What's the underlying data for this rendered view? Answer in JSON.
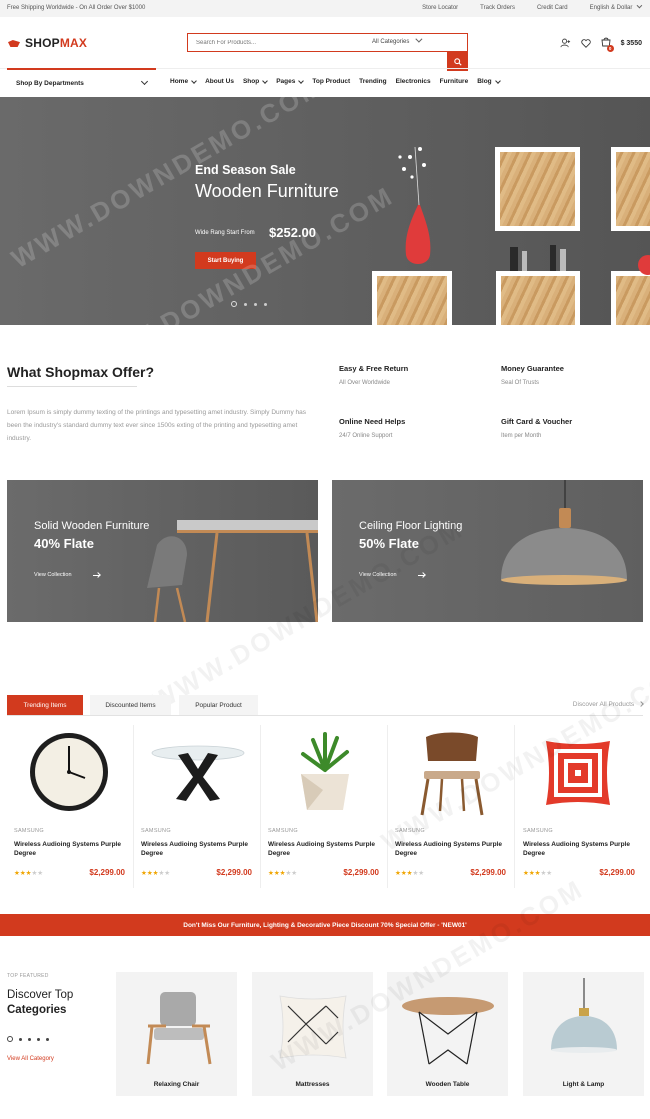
{
  "topbar": {
    "shipping": "Free Shipping Worldwide - On All Order Over $1000",
    "links": [
      "Store Locator",
      "Track Orders",
      "Credit Card",
      "English & Dollar"
    ]
  },
  "header": {
    "logo_part1": "SHOP",
    "logo_part2": "MAX",
    "search_placeholder": "Search For Products...",
    "category_select": "All Categories",
    "cart_total": "$ 3550",
    "cart_count": "0"
  },
  "nav": {
    "departments": "Shop By Departments",
    "items": [
      {
        "label": "Home",
        "dropdown": true
      },
      {
        "label": "About Us",
        "dropdown": false
      },
      {
        "label": "Shop",
        "dropdown": true
      },
      {
        "label": "Pages",
        "dropdown": true
      },
      {
        "label": "Top Product",
        "dropdown": false
      },
      {
        "label": "Trending",
        "dropdown": false
      },
      {
        "label": "Electronics",
        "dropdown": false
      },
      {
        "label": "Furniture",
        "dropdown": false
      },
      {
        "label": "Blog",
        "dropdown": true
      }
    ]
  },
  "hero": {
    "headline": "End Season Sale",
    "title": "Wooden Furniture",
    "from_text": "Wide Rang Start From",
    "price": "$252.00",
    "button": "Start Buying"
  },
  "offer": {
    "title": "What Shopmax Offer?",
    "description": "Lorem Ipsum is simply dummy texting of the printings and typesetting amet industry. Simply Dummy has been the industry's standard dummy text ever since 1500s exting of the printing and typesetting amet industry.",
    "features": [
      {
        "title": "Easy & Free Return",
        "sub": "All Over Worldwide"
      },
      {
        "title": "Money Guarantee",
        "sub": "Seal Of Trusts"
      },
      {
        "title": "Online Need Helps",
        "sub": "24/7 Online Support"
      },
      {
        "title": "Gift Card & Voucher",
        "sub": "Item per Month"
      }
    ]
  },
  "banners": [
    {
      "title": "Solid Wooden Furniture",
      "discount": "40% Flate",
      "link": "View Collection"
    },
    {
      "title": "Ceiling Floor Lighting",
      "discount": "50% Flate",
      "link": "View Collection"
    }
  ],
  "tabs": {
    "items": [
      "Trending Items",
      "Discounted Items",
      "Popular Product"
    ],
    "discover": "Discover All Products"
  },
  "products": [
    {
      "brand": "SAMSUNG",
      "name": "Wireless Audioing Systems Purple Degree",
      "price": "$2,299.00",
      "rating": 3
    },
    {
      "brand": "SAMSUNG",
      "name": "Wireless Audioing Systems Purple Degree",
      "price": "$2,299.00",
      "rating": 3
    },
    {
      "brand": "SAMSUNG",
      "name": "Wireless Audioing Systems Purple Degree",
      "price": "$2,299.00",
      "rating": 3
    },
    {
      "brand": "SAMSUNG",
      "name": "Wireless Audioing Systems Purple Degree",
      "price": "$2,299.00",
      "rating": 3
    },
    {
      "brand": "SAMSUNG",
      "name": "Wireless Audioing Systems Purple Degree",
      "price": "$2,299.00",
      "rating": 3
    }
  ],
  "promo": "Don't Miss Our Furniture, Lighting & Decorative Piece Discount 70% Special Offer - 'NEW01'",
  "categories": {
    "eyebrow": "TOP FEATURED",
    "title_line1": "Discover Top",
    "title_line2": "Categories",
    "view_all": "View All Category",
    "items": [
      "Relaxing Chair",
      "Mattresses",
      "Wooden Table",
      "Light & Lamp"
    ]
  },
  "watermark": "WWW.DOWNDEMO.COM",
  "colors": {
    "accent": "#d23a1e",
    "hero_bg": "#616161",
    "banner_bg": "#6c6c6c"
  }
}
